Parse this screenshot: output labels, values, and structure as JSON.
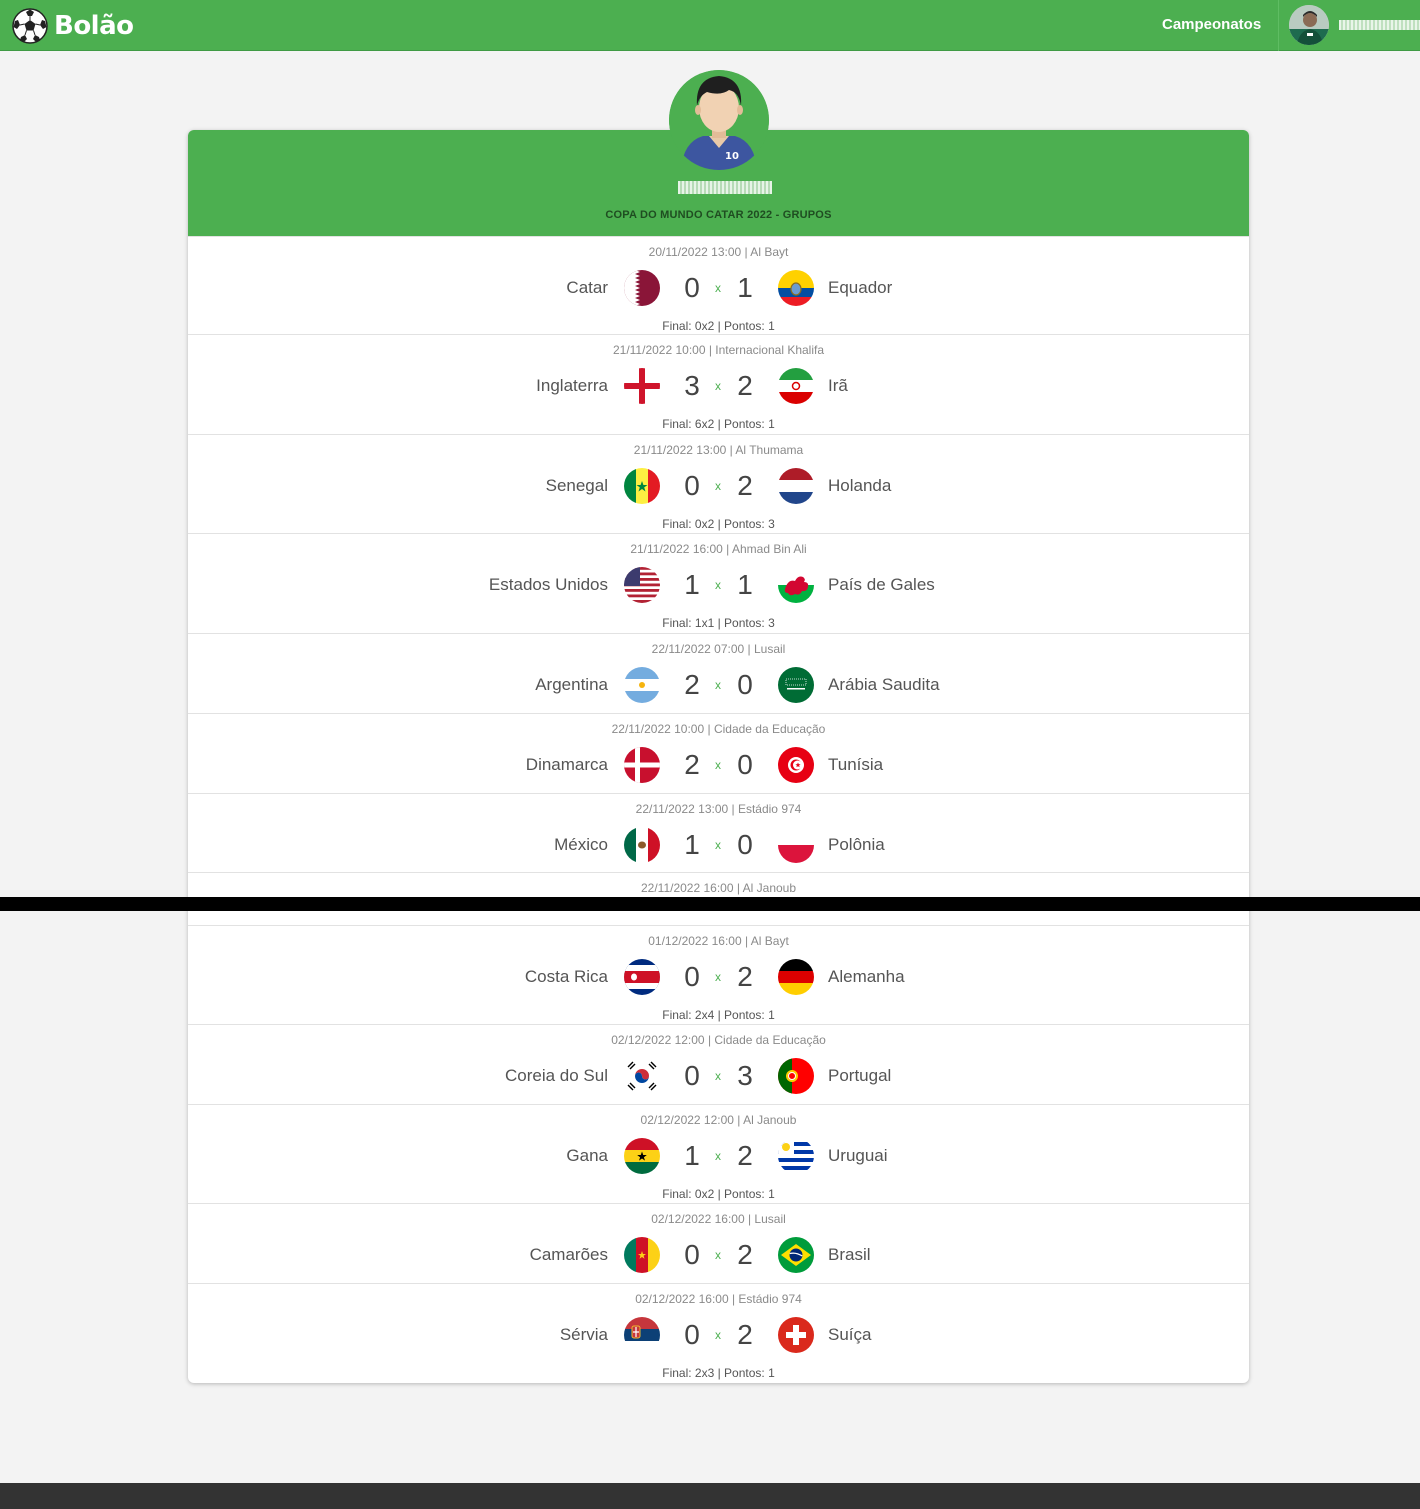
{
  "header": {
    "brand": "Bolão",
    "nav_label": "Campeonatos"
  },
  "profile": {
    "jersey_number": "10"
  },
  "championship_title": "COPA DO MUNDO CATAR 2022 - GRUPOS",
  "matches": [
    {
      "meta": "20/11/2022 13:00 | Al Bayt",
      "home": "Catar",
      "away": "Equador",
      "home_flag": "qatar-flag-icon",
      "away_flag": "ecuador-flag-icon",
      "home_score": "0",
      "away_score": "1",
      "vs": "x",
      "result": "Final: 0x2 | Pontos: 1"
    },
    {
      "meta": "21/11/2022 10:00 | Internacional Khalifa",
      "home": "Inglaterra",
      "away": "Irã",
      "home_flag": "england-flag-icon",
      "away_flag": "iran-flag-icon",
      "home_score": "3",
      "away_score": "2",
      "vs": "x",
      "result": "Final: 6x2 | Pontos: 1"
    },
    {
      "meta": "21/11/2022 13:00 | Al Thumama",
      "home": "Senegal",
      "away": "Holanda",
      "home_flag": "senegal-flag-icon",
      "away_flag": "netherlands-flag-icon",
      "home_score": "0",
      "away_score": "2",
      "vs": "x",
      "result": "Final: 0x2 | Pontos: 3"
    },
    {
      "meta": "21/11/2022 16:00 | Ahmad Bin Ali",
      "home": "Estados Unidos",
      "away": "País de Gales",
      "home_flag": "usa-flag-icon",
      "away_flag": "wales-flag-icon",
      "home_score": "1",
      "away_score": "1",
      "vs": "x",
      "result": "Final: 1x1 | Pontos: 3"
    },
    {
      "meta": "22/11/2022 07:00 | Lusail",
      "home": "Argentina",
      "away": "Arábia Saudita",
      "home_flag": "argentina-flag-icon",
      "away_flag": "saudi-arabia-flag-icon",
      "home_score": "2",
      "away_score": "0",
      "vs": "x",
      "result": ""
    },
    {
      "meta": "22/11/2022 10:00 | Cidade da Educação",
      "home": "Dinamarca",
      "away": "Tunísia",
      "home_flag": "denmark-flag-icon",
      "away_flag": "tunisia-flag-icon",
      "home_score": "2",
      "away_score": "0",
      "vs": "x",
      "result": ""
    },
    {
      "meta": "22/11/2022 13:00 | Estádio 974",
      "home": "México",
      "away": "Polônia",
      "home_flag": "mexico-flag-icon",
      "away_flag": "poland-flag-icon",
      "home_score": "1",
      "away_score": "0",
      "vs": "x",
      "result": ""
    },
    {
      "meta": "22/11/2022 16:00 | Al Janoub",
      "home": "",
      "away": "",
      "home_flag": "",
      "away_flag": "",
      "home_score": "",
      "away_score": "",
      "vs": "",
      "result": ""
    },
    {
      "meta": "01/12/2022 16:00 | Al Bayt",
      "home": "Costa Rica",
      "away": "Alemanha",
      "home_flag": "costa-rica-flag-icon",
      "away_flag": "germany-flag-icon",
      "home_score": "0",
      "away_score": "2",
      "vs": "x",
      "result": "Final: 2x4 | Pontos: 1"
    },
    {
      "meta": "02/12/2022 12:00 | Cidade da Educação",
      "home": "Coreia do Sul",
      "away": "Portugal",
      "home_flag": "south-korea-flag-icon",
      "away_flag": "portugal-flag-icon",
      "home_score": "0",
      "away_score": "3",
      "vs": "x",
      "result": ""
    },
    {
      "meta": "02/12/2022 12:00 | Al Janoub",
      "home": "Gana",
      "away": "Uruguai",
      "home_flag": "ghana-flag-icon",
      "away_flag": "uruguay-flag-icon",
      "home_score": "1",
      "away_score": "2",
      "vs": "x",
      "result": "Final: 0x2 | Pontos: 1"
    },
    {
      "meta": "02/12/2022 16:00 | Lusail",
      "home": "Camarões",
      "away": "Brasil",
      "home_flag": "cameroon-flag-icon",
      "away_flag": "brazil-flag-icon",
      "home_score": "0",
      "away_score": "2",
      "vs": "x",
      "result": ""
    },
    {
      "meta": "02/12/2022 16:00 | Estádio 974",
      "home": "Sérvia",
      "away": "Suíça",
      "home_flag": "serbia-flag-icon",
      "away_flag": "switzerland-flag-icon",
      "home_score": "0",
      "away_score": "2",
      "vs": "x",
      "result": "Final: 2x3 | Pontos: 1"
    }
  ],
  "colors": {
    "brand_green": "#4caf50",
    "vs_green": "#4caf50",
    "footer": "#333333",
    "background": "#f3f3f3"
  }
}
